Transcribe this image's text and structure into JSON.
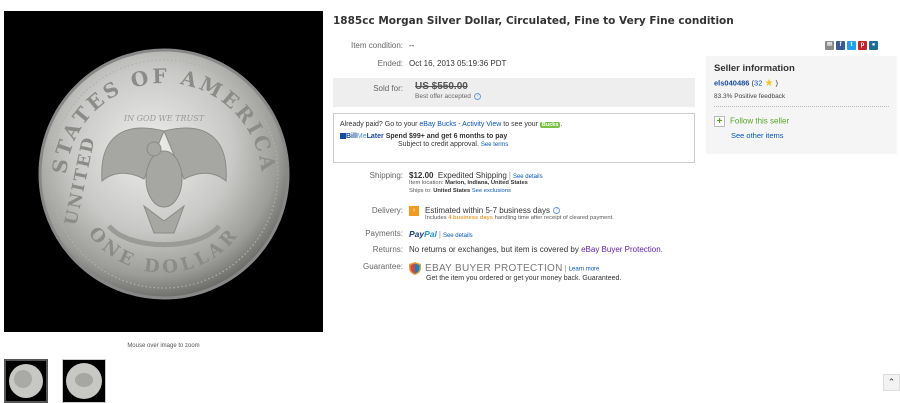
{
  "title": "1885cc Morgan Silver Dollar, Circulated, Fine to Very Fine condition",
  "image": {
    "zoom_hint": "Mouse over image to zoom",
    "coin_text_top": "STATES OF AMERICA",
    "coin_text_left": "UNITED",
    "coin_text_bottom": "ONE DOLLAR",
    "coin_motto": "IN GOD WE TRUST"
  },
  "details": {
    "condition_label": "Item condition:",
    "condition_value": "--",
    "ended_label": "Ended:",
    "ended_value": "Oct 16, 2013  05:19:36 PDT",
    "sold_label": "Sold for:",
    "sold_price": "US $550.00",
    "best_offer": "Best offer accepted"
  },
  "paid_box": {
    "prefix": "Already paid? Go to your ",
    "bucks_link": "eBay Bucks - Activity View",
    "middle": " to see your ",
    "bucks_badge": "Bucks",
    "suffix": ".",
    "bml_logo_a": "Bill",
    "bml_logo_b": "Me",
    "bml_logo_c": "Later",
    "bml_offer": "Spend $99+ and get 6 months to pay",
    "bml_sub": "Subject to credit approval.",
    "bml_terms": "See terms"
  },
  "shipping": {
    "label": "Shipping:",
    "price": "$12.00",
    "method": "Expedited Shipping",
    "details_link": "See details",
    "location_label": "Item location:",
    "location": "Marion, Indiana, United States",
    "ships_to_label": "Ships to:",
    "ships_to": "United States",
    "exclusions_link": "See exclusions"
  },
  "delivery": {
    "label": "Delivery:",
    "estimate": "Estimated within 5-7 business days",
    "includes": "Includes ",
    "handling_days": "4 business days",
    "handling_rest": " handling time after receipt of cleared payment."
  },
  "payments": {
    "label": "Payments:",
    "paypal_a": "Pay",
    "paypal_b": "Pal",
    "details_link": "See details"
  },
  "returns": {
    "label": "Returns:",
    "text": "No returns or exchanges, but item is covered by ",
    "link": "eBay Buyer Protection."
  },
  "guarantee": {
    "label": "Guarantee:",
    "program": "EBAY BUYER PROTECTION",
    "learn_more": "Learn more",
    "text": "Get the item you ordered or get your money back. Guaranteed."
  },
  "seller": {
    "title": "Seller information",
    "name": "els040486",
    "score_open": "(",
    "score": "32",
    "score_close": ")",
    "feedback": "83.3% Positive feedback",
    "follow": "Follow this seller",
    "see_other": "See other items"
  },
  "share_icons": [
    {
      "name": "email-icon",
      "glyph": "✉",
      "color": "#8a8a8a"
    },
    {
      "name": "facebook-icon",
      "glyph": "f",
      "color": "#3b5998"
    },
    {
      "name": "twitter-icon",
      "glyph": "t",
      "color": "#1da1f2"
    },
    {
      "name": "pinterest-icon",
      "glyph": "p",
      "color": "#cb2027"
    },
    {
      "name": "chat-icon",
      "glyph": "●",
      "color": "#1b6e94"
    }
  ],
  "colors": {
    "link": "#0654ba",
    "accent_orange": "#f39b1f",
    "bucks_green": "#7ac143",
    "sold_box_bg": "#eeeeee",
    "seller_box_bg": "#f5f5f5"
  },
  "back_to_top_glyph": "⌃"
}
